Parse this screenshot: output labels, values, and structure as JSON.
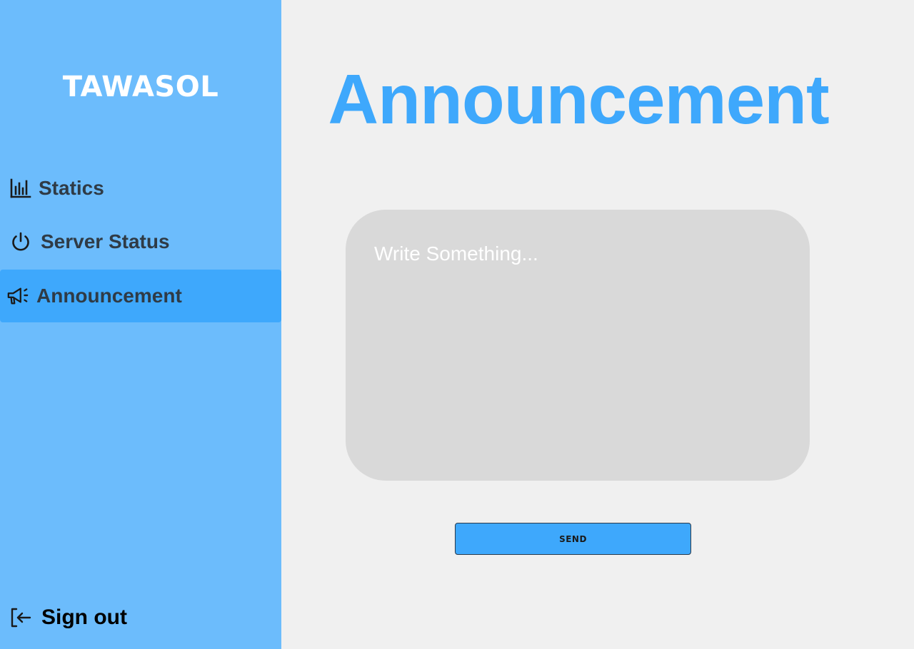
{
  "sidebar": {
    "brand": "TAWASOL",
    "items": [
      {
        "label": "Statics",
        "icon": "bar-chart-icon"
      },
      {
        "label": "Server Status",
        "icon": "power-icon"
      },
      {
        "label": "Announcement",
        "icon": "megaphone-icon",
        "active": true
      }
    ],
    "signout": {
      "label": "Sign out",
      "icon": "sign-out-icon"
    }
  },
  "main": {
    "title": "Announcement",
    "message": {
      "placeholder": "Write Something...",
      "value": ""
    },
    "send_label": "SEND"
  },
  "colors": {
    "sidebar_bg": "#6cbcfc",
    "accent": "#3ea8fc",
    "page_bg": "#f0f0f0",
    "input_bg": "#d9d9d9",
    "nav_text": "#2f3b46"
  }
}
